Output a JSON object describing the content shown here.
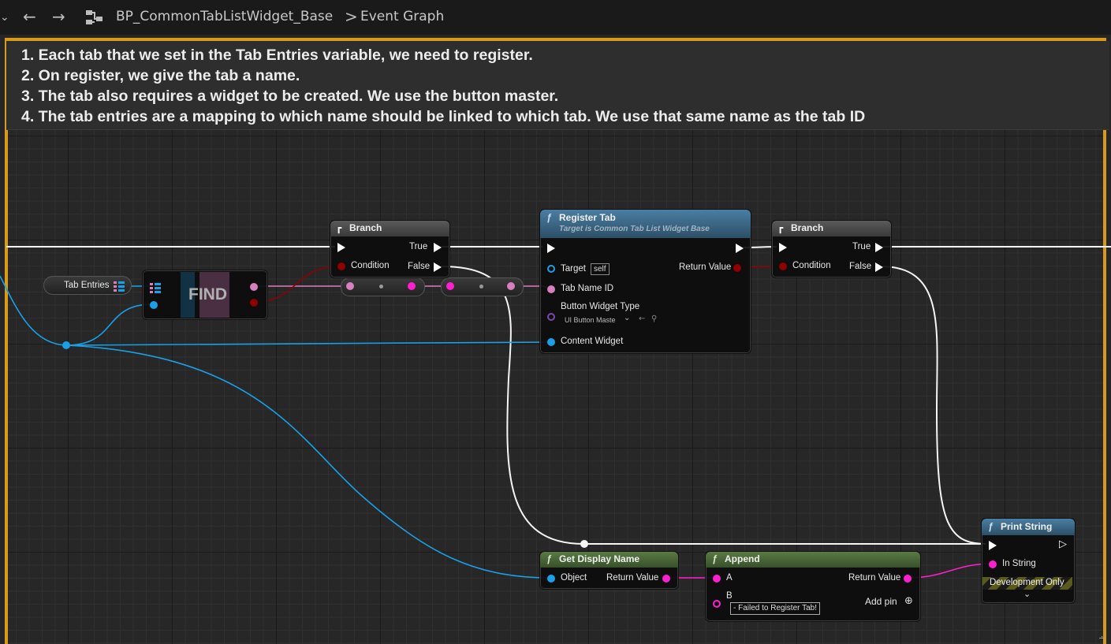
{
  "toolbar": {
    "back_icon": "arrow-left-icon",
    "forward_icon": "arrow-right-icon",
    "graph_icon": "blueprint-graph-icon",
    "breadcrumb_asset": "BP_CommonTabListWidget_Base",
    "breadcrumb_separator": ">",
    "breadcrumb_graph": "Event Graph"
  },
  "comment": {
    "lines": [
      "1. Each tab that we set in the Tab Entries variable, we need to register.",
      "2. On register, we give the tab a name.",
      "3. The tab also requires a widget to be created. We use the button master.",
      "4. The tab entries are a mapping to which name should be linked to which tab. We use that same name as the tab ID"
    ],
    "border_color": "#d99a18"
  },
  "nodes": {
    "tab_entries": {
      "label": "Tab Entries"
    },
    "find": {
      "label": "FIND"
    },
    "branch1": {
      "title": "Branch",
      "condition": "Condition",
      "true_label": "True",
      "false_label": "False"
    },
    "register_tab": {
      "title": "Register Tab",
      "subtitle": "Target is Common Tab List Widget Base",
      "target": "Target",
      "target_default": "self",
      "tab_name_id": "Tab Name ID",
      "button_widget_type": "Button Widget Type",
      "button_widget_value": "UI Button Maste",
      "content_widget": "Content Widget",
      "return_value": "Return Value"
    },
    "branch2": {
      "title": "Branch",
      "condition": "Condition",
      "true_label": "True",
      "false_label": "False"
    },
    "print_string": {
      "title": "Print String",
      "in_string": "In String",
      "dev_only": "Development Only"
    },
    "get_display_name": {
      "title": "Get Display Name",
      "object": "Object",
      "return_value": "Return Value"
    },
    "append": {
      "title": "Append",
      "a": "A",
      "b": "B",
      "b_default": "- Failed to Register Tab!",
      "return_value": "Return Value",
      "add_pin": "Add pin"
    }
  },
  "colors": {
    "exec": "#ffffff",
    "object_pin": "#1aa0e6",
    "name_pin": "#d77fbf",
    "string_pin": "#ff1fd0",
    "bool_pin": "#8f0000",
    "function_header": "#3c6e92",
    "pure_header": "#4f6b3a",
    "branch_header": "#505050"
  }
}
